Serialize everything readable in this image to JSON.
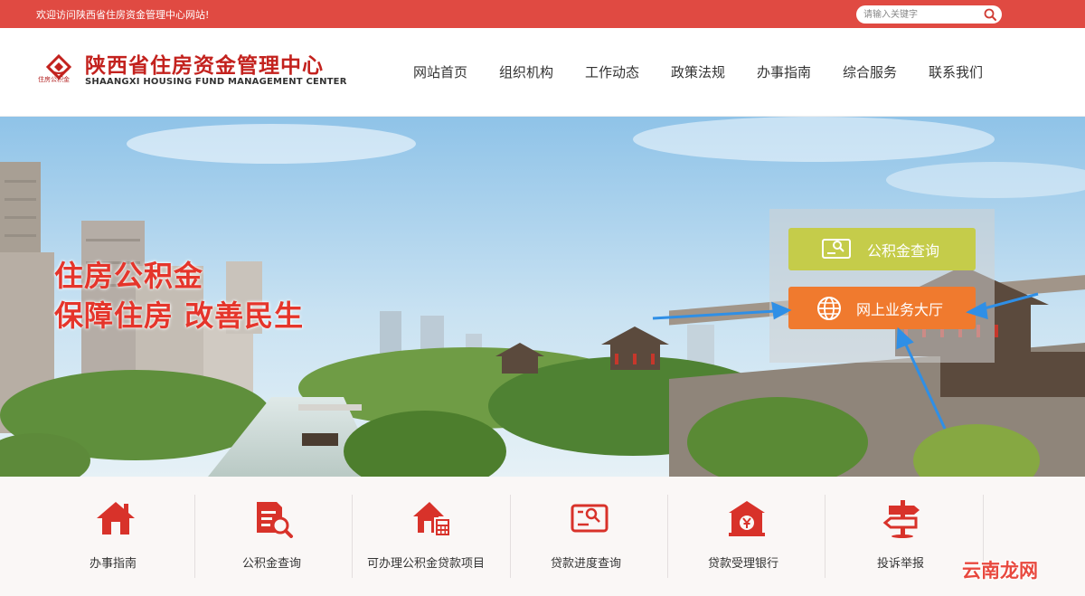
{
  "topbar": {
    "welcome": "欢迎访问陕西省住房资金管理中心网站!",
    "search_placeholder": "请输入关键字",
    "bg_color": "#e04a42"
  },
  "header": {
    "logo_mark_text": "住房公积金",
    "title_cn": "陕西省住房资金管理中心",
    "title_en": "SHAANGXI HOUSING FUND MANAGEMENT CENTER",
    "nav": [
      "网站首页",
      "组织机构",
      "工作动态",
      "政策法规",
      "办事指南",
      "综合服务",
      "联系我们"
    ]
  },
  "banner": {
    "slogan_line1": "住房公积金",
    "slogan_line2": "保障住房  改善民生",
    "btn_fund_query": "公积金查询",
    "btn_online_hall": "网上业务大厅",
    "fund_color": "#c5cc4a",
    "hall_color": "#f07a2e"
  },
  "services": [
    {
      "label": "办事指南",
      "icon": "house-icon"
    },
    {
      "label": "公积金查询",
      "icon": "document-search-icon"
    },
    {
      "label": "可办理公积金贷款项目",
      "icon": "house-calculator-icon"
    },
    {
      "label": "贷款进度查询",
      "icon": "id-card-icon"
    },
    {
      "label": "贷款受理银行",
      "icon": "bank-yuan-icon"
    },
    {
      "label": "投诉举报",
      "icon": "signpost-icon"
    }
  ],
  "watermark": "云南龙网"
}
